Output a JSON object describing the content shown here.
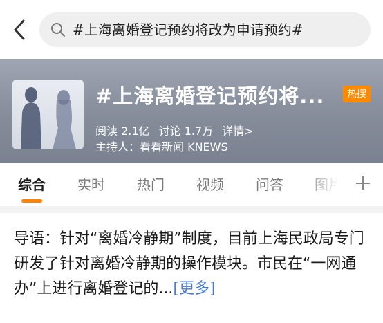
{
  "search": {
    "query": "#上海离婚登记预约将改为申请预约#"
  },
  "topic": {
    "title": "#上海离婚登记预约将...",
    "badge": "热搜",
    "reads": "阅读 2.1亿",
    "discussions": "讨论 1.7万",
    "details": "详情>",
    "host": "主持人：看看新闻 KNEWS"
  },
  "tabs": [
    {
      "label": "综合"
    },
    {
      "label": "实时"
    },
    {
      "label": "热门"
    },
    {
      "label": "视频"
    },
    {
      "label": "问答"
    },
    {
      "label": "图片"
    }
  ],
  "intro": {
    "text": "导语：针对“离婚冷静期”制度，目前上海民政局专门研发了针对离婚冷静期的操作模块。市民在“一网通办”上进行离婚登记的...",
    "more": "[更多]"
  },
  "colors": {
    "accent": "#ff8200",
    "badge": "#ff8a00",
    "link": "#4a7bd0"
  },
  "icons": {
    "back": "chevron-left-icon",
    "search": "search-icon",
    "add": "plus-icon"
  }
}
